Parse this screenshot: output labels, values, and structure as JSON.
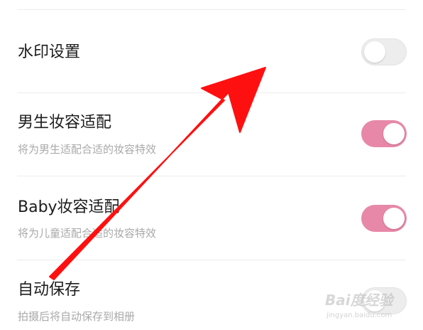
{
  "settings": {
    "items": [
      {
        "title": "水印设置",
        "subtitle": "",
        "toggle": "off"
      },
      {
        "title": "男生妆容适配",
        "subtitle": "将为男生适配合适的妆容特效",
        "toggle": "on"
      },
      {
        "title": "Baby妆容适配",
        "subtitle": "将为儿童适配合适的妆容特效",
        "toggle": "on"
      },
      {
        "title": "自动保存",
        "subtitle": "拍摄后将自动保存到相册",
        "toggle": "off"
      }
    ]
  },
  "colors": {
    "toggle_on": "#e888a8",
    "toggle_off": "#ededed",
    "annotation_arrow": "#ff1010"
  },
  "watermark": {
    "brand": "Bai度经验",
    "url": "jingyan.baidu.com"
  },
  "annotation": {
    "icon": "red-arrow-icon"
  }
}
